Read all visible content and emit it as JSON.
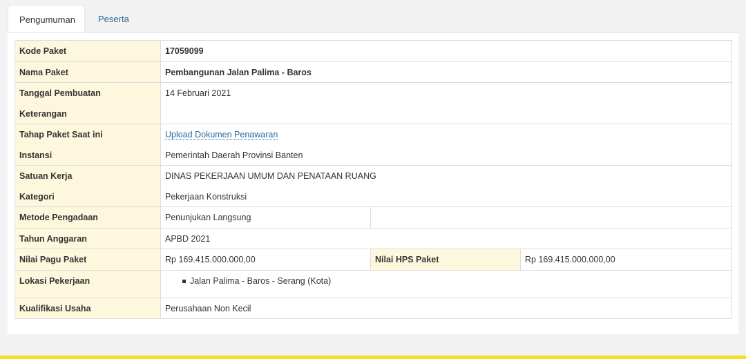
{
  "tabs": [
    {
      "label": "Pengumuman",
      "active": true
    },
    {
      "label": "Peserta",
      "active": false
    }
  ],
  "paket": {
    "kode_label": "Kode Paket",
    "kode_value": "17059099",
    "nama_label": "Nama Paket",
    "nama_value": "Pembangunan Jalan Palima - Baros",
    "tanggal_label": "Tanggal Pembuatan",
    "tanggal_value": "14 Februari 2021",
    "keterangan_label": "Keterangan",
    "keterangan_value": "",
    "tahap_label": "Tahap Paket Saat ini",
    "tahap_value": "Upload Dokumen Penawaran",
    "instansi_label": "Instansi",
    "instansi_value": "Pemerintah Daerah Provinsi Banten",
    "satker_label": "Satuan Kerja",
    "satker_value": "DINAS PEKERJAAN UMUM DAN PENATAAN RUANG",
    "kategori_label": "Kategori",
    "kategori_value": "Pekerjaan Konstruksi",
    "metode_label": "Metode Pengadaan",
    "metode_value": "Penunjukan Langsung",
    "tahun_label": "Tahun Anggaran",
    "tahun_value": "APBD 2021",
    "pagu_label": "Nilai Pagu Paket",
    "pagu_value": "Rp 169.415.000.000,00",
    "hps_label": "Nilai HPS Paket",
    "hps_value": "Rp 169.415.000.000,00",
    "lokasi_label": "Lokasi Pekerjaan",
    "lokasi_items": [
      "Jalan Palima - Baros - Serang (Kota)"
    ],
    "kualifikasi_label": "Kualifikasi Usaha",
    "kualifikasi_value": "Perusahaan Non Kecil"
  },
  "colors": {
    "label_bg": "#fdf8dd",
    "link": "#2a6a9e",
    "footer_bar": "#f4e01e"
  }
}
